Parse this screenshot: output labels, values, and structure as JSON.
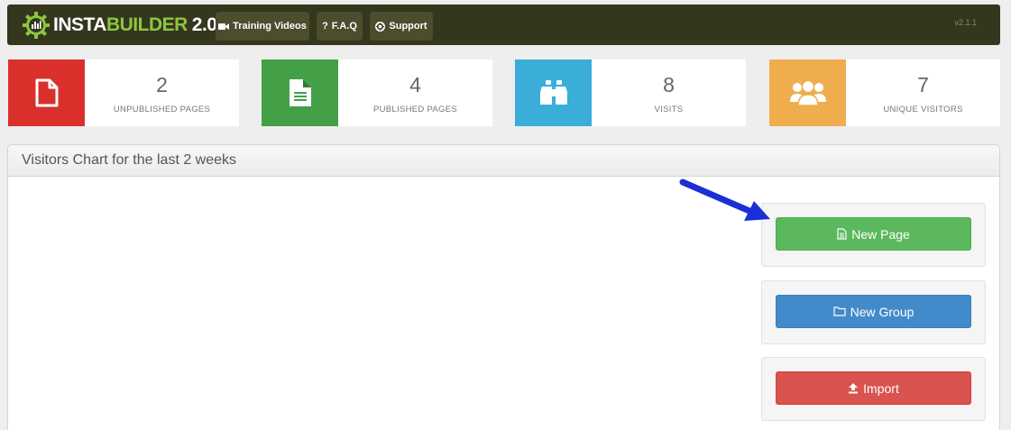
{
  "header": {
    "logo": {
      "part1": "INSTA",
      "part2": "BUILDER",
      "part3": "2.0"
    },
    "nav": [
      {
        "label": "Training Videos",
        "icon": "video-camera-icon"
      },
      {
        "label": "F.A.Q",
        "icon": "question-icon"
      },
      {
        "label": "Support",
        "icon": "lifebuoy-icon"
      }
    ],
    "version": "v2.1.1"
  },
  "stats": [
    {
      "value": "2",
      "label": "UNPUBLISHED PAGES",
      "icon": "blank-file-icon",
      "color": "#d9302c"
    },
    {
      "value": "4",
      "label": "PUBLISHED PAGES",
      "icon": "text-file-icon",
      "color": "#43a047"
    },
    {
      "value": "8",
      "label": "VISITS",
      "icon": "binoculars-icon",
      "color": "#3aaed8"
    },
    {
      "value": "7",
      "label": "UNIQUE VISITORS",
      "icon": "users-icon",
      "color": "#f0ad4e"
    }
  ],
  "panel": {
    "title": "Visitors Chart for the last 2 weeks",
    "actions": [
      {
        "label": "New Page",
        "icon": "file-icon",
        "color": "#5cb85c"
      },
      {
        "label": "New Group",
        "icon": "folder-icon",
        "color": "#428bca"
      },
      {
        "label": "Import",
        "icon": "upload-icon",
        "color": "#d9534f"
      }
    ]
  },
  "annotation": {
    "icon": "arrow-icon",
    "color": "#1a2fd6"
  }
}
